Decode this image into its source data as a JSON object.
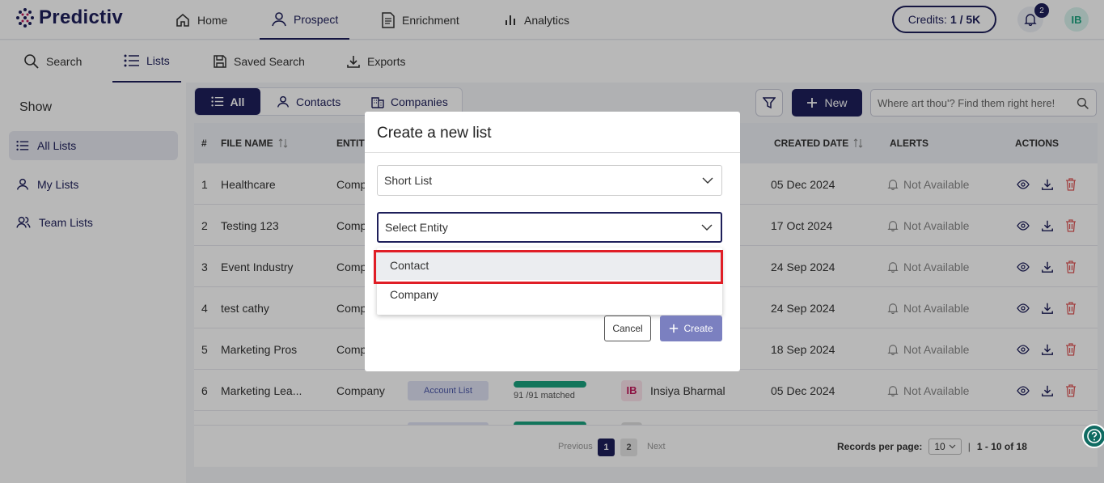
{
  "app": {
    "logo_text": "Predictiv"
  },
  "topnav": {
    "tabs": [
      {
        "label": "Home",
        "icon": "home-icon"
      },
      {
        "label": "Prospect",
        "icon": "user-icon",
        "active": true
      },
      {
        "label": "Enrichment",
        "icon": "document-icon"
      },
      {
        "label": "Analytics",
        "icon": "bar-chart-icon"
      }
    ],
    "credits_label": "Credits:",
    "credits_value": "1 / 5K",
    "notification_count": "2",
    "user_initials": "IB"
  },
  "subnav": {
    "tabs": [
      {
        "label": "Search",
        "icon": "search-icon"
      },
      {
        "label": "Lists",
        "icon": "list-icon",
        "active": true
      },
      {
        "label": "Saved Search",
        "icon": "save-icon"
      },
      {
        "label": "Exports",
        "icon": "download-icon"
      }
    ]
  },
  "sidebar": {
    "title": "Show",
    "items": [
      {
        "label": "All Lists",
        "icon": "list-icon",
        "active": true
      },
      {
        "label": "My Lists",
        "icon": "user-icon"
      },
      {
        "label": "Team Lists",
        "icon": "team-icon"
      }
    ]
  },
  "toolbar": {
    "segments": [
      {
        "label": "All",
        "active": true
      },
      {
        "label": "Contacts"
      },
      {
        "label": "Companies"
      }
    ],
    "new_label": "New",
    "search_placeholder": "Where art thou'? Find them right here!"
  },
  "table": {
    "headers": {
      "num": "#",
      "file_name": "FILE NAME",
      "entity": "ENTITY",
      "created_date": "CREATED DATE",
      "alerts": "ALERTS",
      "actions": "ACTIONS"
    },
    "rows": [
      {
        "num": "1",
        "name": "Healthcare",
        "entity": "Company",
        "created": "05 Dec 2024",
        "alert": "Not Available"
      },
      {
        "num": "2",
        "name": "Testing 123",
        "entity": "Company",
        "created": "17 Oct 2024",
        "alert": "Not Available"
      },
      {
        "num": "3",
        "name": "Event Industry",
        "entity": "Company",
        "created": "24 Sep 2024",
        "alert": "Not Available"
      },
      {
        "num": "4",
        "name": "test cathy",
        "entity": "Company",
        "created": "24 Sep 2024",
        "alert": "Not Available"
      },
      {
        "num": "5",
        "name": "Marketing Pros",
        "entity": "Company",
        "created": "18 Sep 2024",
        "alert": "Not Available"
      },
      {
        "num": "6",
        "name": "Marketing Lea...",
        "entity": "Company",
        "type": "Account List",
        "match": "91 /91 matched",
        "owner_initials": "IB",
        "owner": "Insiya Bharmal",
        "created": "05 Dec 2024",
        "alert": "Not Available"
      }
    ]
  },
  "pagination": {
    "previous": "Previous",
    "pages": [
      "1",
      "2"
    ],
    "next": "Next",
    "rpp_label": "Records per page:",
    "rpp_value": "10",
    "range": "1 - 10 of 18"
  },
  "modal": {
    "title": "Create a new list",
    "list_type_value": "Short List",
    "entity_placeholder": "Select Entity",
    "options": [
      "Contact",
      "Company"
    ],
    "cancel_label": "Cancel",
    "create_label": "Create"
  },
  "colors": {
    "brand": "#1e1f5a",
    "highlight": "#e01e26",
    "success": "#1aa37e"
  }
}
